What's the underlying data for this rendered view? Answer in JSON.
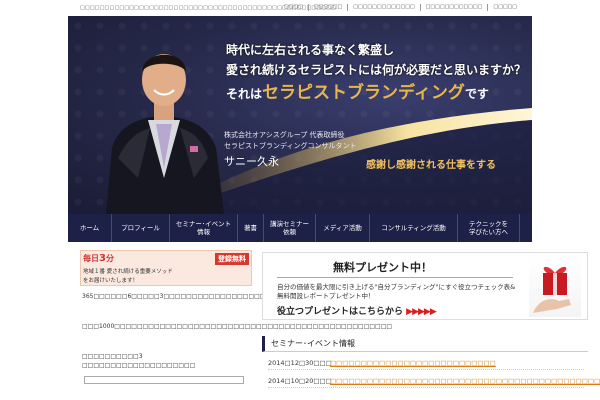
{
  "header": {
    "tagline": "□□□□□□□□□□□□□□□□□□□□□□□□□□□□□□□□□□□□□□□□□□□□□□□□□□□□",
    "links": [
      "□□□□",
      "□□□□□□",
      "□□□□□□□□□□□□□",
      "□□□□□□□□□□□□",
      "□□□□□"
    ]
  },
  "hero": {
    "line1": "時代に左右される事なく繁盛し",
    "line2": "愛され続けるセラピストには何が必要だと思いますか？",
    "line3_pre": "それは",
    "line3_brand": "セラピストブランディング",
    "line3_post": "です",
    "company_line1": "株式会社オアシスグループ 代表取締役",
    "company_line2": "セラピストブランディングコンサルタント",
    "name": "サニー久永",
    "motto": "感謝し感謝される仕事をする"
  },
  "nav": {
    "items": [
      {
        "label": "ホーム"
      },
      {
        "label": "プロフィール"
      },
      {
        "label": "セミナー･イベント\n情報"
      },
      {
        "label": "著書"
      },
      {
        "label": "講演セミナー\n依頼"
      },
      {
        "label": "メディア活動"
      },
      {
        "label": "コンサルティング活動"
      },
      {
        "label": "テクニックを\n学びたい方へ"
      }
    ]
  },
  "sidebar": {
    "daily_prefix": "毎日",
    "daily_num": "3",
    "daily_suffix": "分",
    "free_badge": "登録無料",
    "daily_sub": "地域１番 愛され続ける重要メソッド",
    "daily_sub2": "をお届けいたします！",
    "para1": "365□□□□□□6□□□□□3□□□□□□□□□□□□□□□□□□□□□□□□□□□□□□□□□□□□□□□□1□□□□□□□□□□□□□□□□□□□",
    "para2": "□□□1000□□□□□□□□□□□□□□□□□□□□□□□□□□□□□□□□□□□□□□□□□□□□□□□□□",
    "para3": "□□□□□□□□□□3 □□□□□□□□□□□□□□□□□□□□"
  },
  "present": {
    "title": "無料プレゼント中！",
    "desc": "自分の価値を最大限に引き上げる\"自分ブランディング\"にすぐ役立つチェック表&無料開設レポートプレゼント中！",
    "cta": "役立つプレゼントはこちらから",
    "cta_arrows": "▶▶▶▶▶"
  },
  "seminars": {
    "heading": "セミナー･イベント情報",
    "rows": [
      {
        "date": "2014□12□30□□□",
        "title": "□□□□□□□□□□□□□□□□□□□□□□□□□□□"
      },
      {
        "date": "2014□10□20□□□",
        "title": "□□□□□□□□□□□□□□□□□□□□□□□□□□□□□□□□□□□□□□□□□□□□□"
      }
    ]
  },
  "colors": {
    "navy": "#1e2147",
    "gold": "#e8b74a",
    "red_badge": "#d8382b",
    "link_orange": "#d87b12"
  }
}
